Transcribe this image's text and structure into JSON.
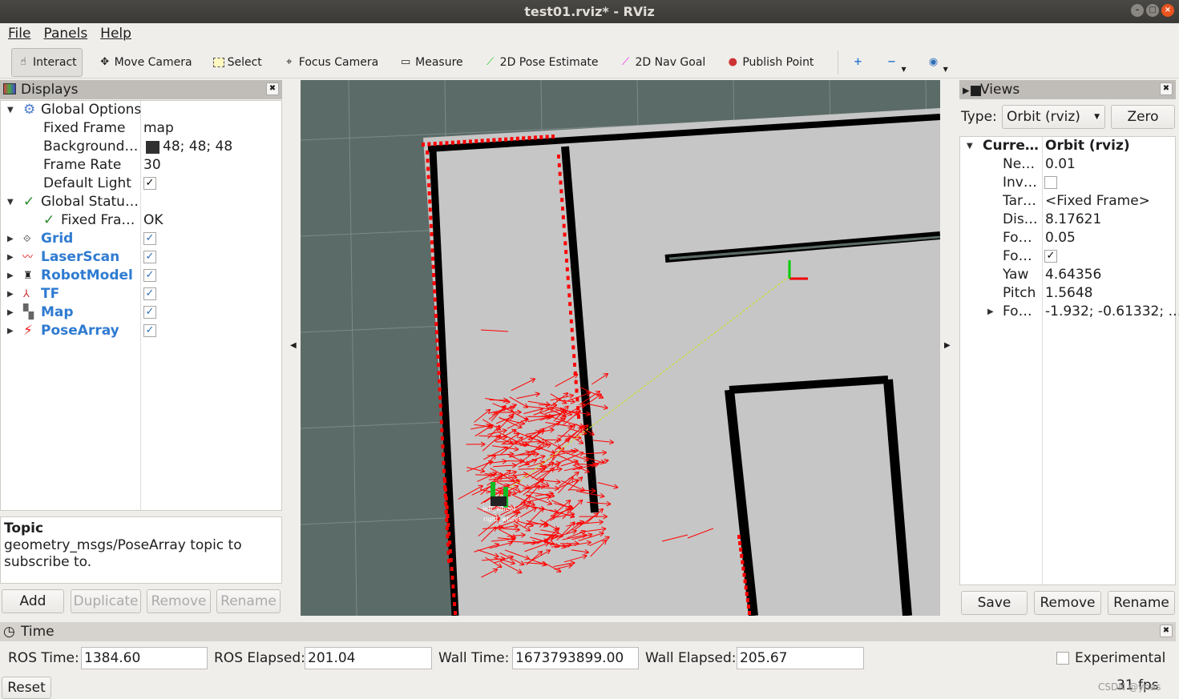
{
  "window": {
    "title": "test01.rviz* - RViz"
  },
  "menu": [
    "File",
    "Panels",
    "Help"
  ],
  "toolbar": {
    "tools": [
      {
        "label": "Interact",
        "icon": "hand-icon"
      },
      {
        "label": "Move Camera",
        "icon": "move-camera-icon"
      },
      {
        "label": "Select",
        "icon": "select-icon"
      },
      {
        "label": "Focus Camera",
        "icon": "focus-camera-icon"
      },
      {
        "label": "Measure",
        "icon": "ruler-icon"
      },
      {
        "label": "2D Pose Estimate",
        "icon": "green-arrow-icon"
      },
      {
        "label": "2D Nav Goal",
        "icon": "magenta-arrow-icon"
      },
      {
        "label": "Publish Point",
        "icon": "map-pin-icon"
      }
    ],
    "active": "Interact"
  },
  "displays": {
    "title": "Displays",
    "global_options": {
      "label": "Global Options",
      "fixed_frame_label": "Fixed Frame",
      "fixed_frame": "map",
      "background_label": "Background…",
      "background": "48; 48; 48",
      "background_color": "#303030",
      "frame_rate_label": "Frame Rate",
      "frame_rate": "30",
      "default_light_label": "Default Light"
    },
    "global_status": {
      "label": "Global Statu…",
      "fixed_frame_label": "Fixed Fra…",
      "fixed_frame": "OK"
    },
    "items": [
      {
        "label": "Grid",
        "checked": true
      },
      {
        "label": "LaserScan",
        "checked": true
      },
      {
        "label": "RobotModel",
        "checked": true
      },
      {
        "label": "TF",
        "checked": true
      },
      {
        "label": "Map",
        "checked": true
      },
      {
        "label": "PoseArray",
        "checked": true
      }
    ],
    "help_title": "Topic",
    "help_text": "geometry_msgs/PoseArray topic to subscribe to.",
    "buttons": {
      "add": "Add",
      "duplicate": "Duplicate",
      "remove": "Remove",
      "rename": "Rename"
    }
  },
  "views": {
    "title": "Views",
    "type_label": "Type:",
    "type_value": "Orbit (rviz)",
    "zero": "Zero",
    "current_label": "Curre…",
    "current_value": "Orbit (rviz)",
    "props": [
      {
        "k": "Ne…",
        "v": "0.01"
      },
      {
        "k": "Inv…",
        "v": "",
        "checkbox": false
      },
      {
        "k": "Tar…",
        "v": "<Fixed Frame>"
      },
      {
        "k": "Dis…",
        "v": "8.17621"
      },
      {
        "k": "Fo…",
        "v": "0.05"
      },
      {
        "k": "Fo…",
        "v": "",
        "checkbox": true
      },
      {
        "k": "Yaw",
        "v": "4.64356"
      },
      {
        "k": "Pitch",
        "v": "1.5648"
      },
      {
        "k": "Fo…",
        "v": "-1.932; -0.61332; …"
      }
    ],
    "buttons": {
      "save": "Save",
      "remove": "Remove",
      "rename": "Rename"
    }
  },
  "time": {
    "title": "Time",
    "ros_time_label": "ROS Time:",
    "ros_time": "1384.60",
    "ros_elapsed_label": "ROS Elapsed:",
    "ros_elapsed": "201.04",
    "wall_time_label": "Wall Time:",
    "wall_time": "1673793899.00",
    "wall_elapsed_label": "Wall Elapsed:",
    "wall_elapsed": "205.67",
    "experimental": "Experimental",
    "reset": "Reset",
    "fps": "31 fps"
  },
  "watermark": "CSDN @ynas",
  "viewport": {
    "robot_labels": [
      "left_wheel",
      "right_wheel"
    ]
  }
}
